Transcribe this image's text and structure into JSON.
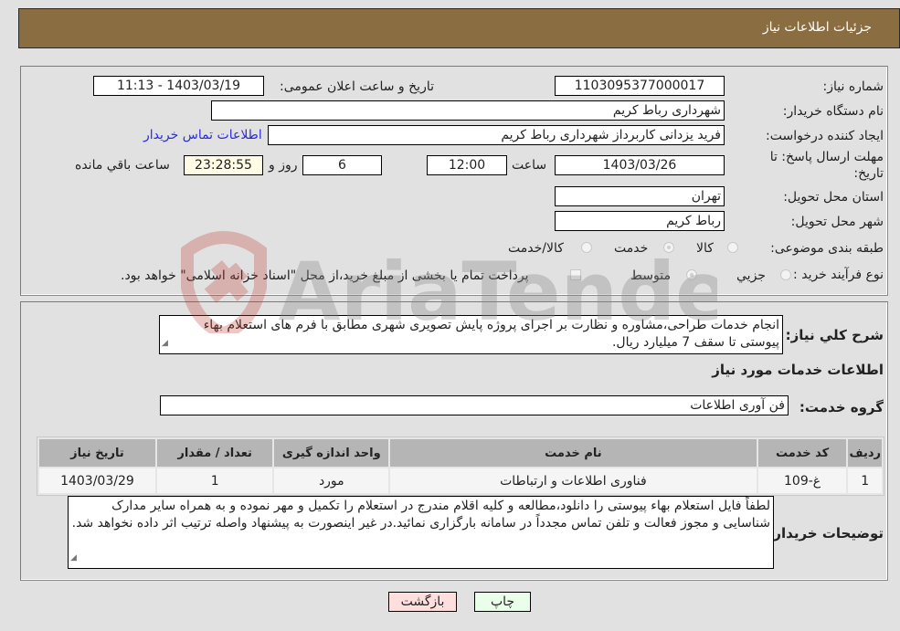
{
  "header": {
    "title": "جزئیات اطلاعات نیاز"
  },
  "need_info": {
    "need_number_label": "شماره نیاز:",
    "need_number": "1103095377000017",
    "announce_label": "تاریخ و ساعت اعلان عمومی:",
    "announce_value": "1403/03/19 - 11:13",
    "buyer_org_label": "نام دستگاه خریدار:",
    "buyer_org": "شهرداری رباط کریم",
    "creator_label": "ایجاد کننده درخواست:",
    "creator": "فرید یزدانی کاربرداز شهرداری رباط کریم",
    "contact_link": "اطلاعات تماس خریدار",
    "deadline_label_1": "مهلت ارسال پاسخ: تا",
    "deadline_label_2": "تاریخ:",
    "deadline_date": "1403/03/26",
    "time_label": "ساعت",
    "deadline_time": "12:00",
    "days_value": "6",
    "days_label": "روز و",
    "remaining_time": "23:28:55",
    "remaining_label": "ساعت باقي مانده",
    "province_label": "استان محل تحویل:",
    "province": "تهران",
    "city_label": "شهر محل تحویل:",
    "city": "رباط کریم",
    "category_label": "طبقه بندی موضوعی:",
    "category_options": [
      "کالا",
      "خدمت",
      "کالا/خدمت"
    ],
    "category_selected": "خدمت",
    "process_label": "نوع فرآیند خرید :",
    "process_options": [
      "جزيي",
      "متوسط"
    ],
    "process_selected": "متوسط",
    "treasury_note": "پرداخت تمام یا بخشی از مبلغ خرید،از محل \"اسناد خزانه اسلامی\" خواهد بود."
  },
  "description": {
    "label": "شرح کلي نياز:",
    "text": "انجام خدمات طراحی،مشاوره و نظارت بر اجرای پروژه پایش تصویری شهری مطابق با فرم های استعلام بهاء پیوستی تا سقف 7 میلیارد ریال."
  },
  "services": {
    "section_title": "اطلاعات خدمات مورد نياز",
    "group_label": "گروه خدمت:",
    "group_value": "فن آوری اطلاعات",
    "table": {
      "headers": [
        "رديف",
        "کد خدمت",
        "نام خدمت",
        "واحد اندازه گیری",
        "تعداد / مقدار",
        "تاریخ نیاز"
      ],
      "rows": [
        [
          "1",
          "غ-109",
          "فناوری اطلاعات و ارتباطات",
          "مورد",
          "1",
          "1403/03/29"
        ]
      ]
    }
  },
  "buyer_notes": {
    "label": "توضیحات خریدار:",
    "text": "لطفاً فایل استعلام بهاء پیوستی را دانلود،مطالعه و کلیه اقلام مندرج در استعلام را تکمیل و مهر نموده و به همراه سایر مدارک شناسایی و مجوز فعالت و تلفن تماس مجدداً در سامانه بارگزاری نمائید.در غیر اینصورت به پیشنهاد واصله ترتیب اثر داده نخواهد شد."
  },
  "buttons": {
    "print": "چاپ",
    "back": "بازگشت"
  },
  "watermark": {
    "text": "AriaTender.neT"
  },
  "colors": {
    "header": "#8b6d42",
    "link": "#2a2ae0",
    "print_btn": "#eaffea",
    "back_btn": "#ffdede",
    "remaining_bg": "#fffbe5"
  }
}
